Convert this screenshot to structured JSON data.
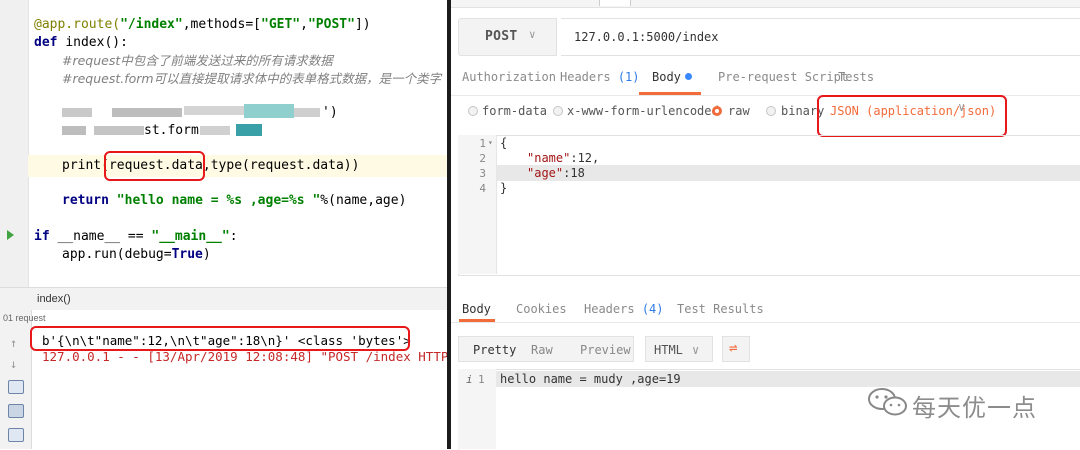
{
  "ide": {
    "code_lines": {
      "route_deco": "@app.route(",
      "route_path": "\"/index\"",
      "route_mid": ",methods=[",
      "route_get": "\"GET\"",
      "route_comma": ",",
      "route_post": "\"POST\"",
      "route_end": "])",
      "def_kw": "def ",
      "def_rest": "index():",
      "comment1": "#request中包含了前端发送过来的所有请求数据",
      "comment2": "#request.form可以直接提取请求体中的表单格式数据，是一个类字",
      "blurred_tail1": "')",
      "blurred_frag2": "st.form.",
      "print_start": "print(",
      "print_arg": "request.data,",
      "print_rest": "type(request.data))",
      "return_kw": "return ",
      "return_str": "\"hello name = %s ,age=%s \"",
      "return_rest": "%(name,age)",
      "if_kw": "if ",
      "if_mid": "__name__ == ",
      "if_str": "\"__main__\"",
      "if_end": ":",
      "run_start": "app.run(debug=",
      "run_true": "True",
      "run_end": ")"
    },
    "breadcrumb": "index()",
    "run_tab_label": "01 request",
    "output": [
      "b'{\\n\\t\"name\":12,\\n\\t\"age\":18\\n}' <class 'bytes'>",
      "127.0.0.1 - - [13/Apr/2019 12:08:48] \"POST /index HTTP/"
    ]
  },
  "postman": {
    "method": "POST",
    "url": "127.0.0.1:5000/index",
    "request_tabs": {
      "authorization": "Authorization",
      "headers": "Headers",
      "headers_count": "(1)",
      "body": "Body",
      "prerequest": "Pre-request Script",
      "tests": "Tests"
    },
    "body_types": {
      "form_data": "form-data",
      "urlencoded": "x-www-form-urlencoded",
      "raw": "raw",
      "binary": "binary",
      "selected": "raw"
    },
    "content_type": "JSON (application/json)",
    "editor": {
      "line_numbers": [
        "1",
        "2",
        "3",
        "4"
      ],
      "l1": "{",
      "l2_key": "\"name\"",
      "l2_val": ":12,",
      "l3_key": "\"age\"",
      "l3_val": ":18",
      "l4": "}"
    },
    "response_tabs": {
      "body": "Body",
      "cookies": "Cookies",
      "headers": "Headers",
      "headers_count": "(4)",
      "test_results": "Test Results"
    },
    "view_buttons": {
      "pretty": "Pretty",
      "raw": "Raw",
      "preview": "Preview",
      "format": "HTML"
    },
    "response": {
      "info": "i",
      "line_number": "1",
      "text": "hello name = mudy ,age=19"
    }
  },
  "watermark": {
    "text": "每天优一点"
  },
  "colors": {
    "accent": "#f26b3a",
    "highlight_box": "#e8171a",
    "link_blue": "#2e7be5"
  }
}
